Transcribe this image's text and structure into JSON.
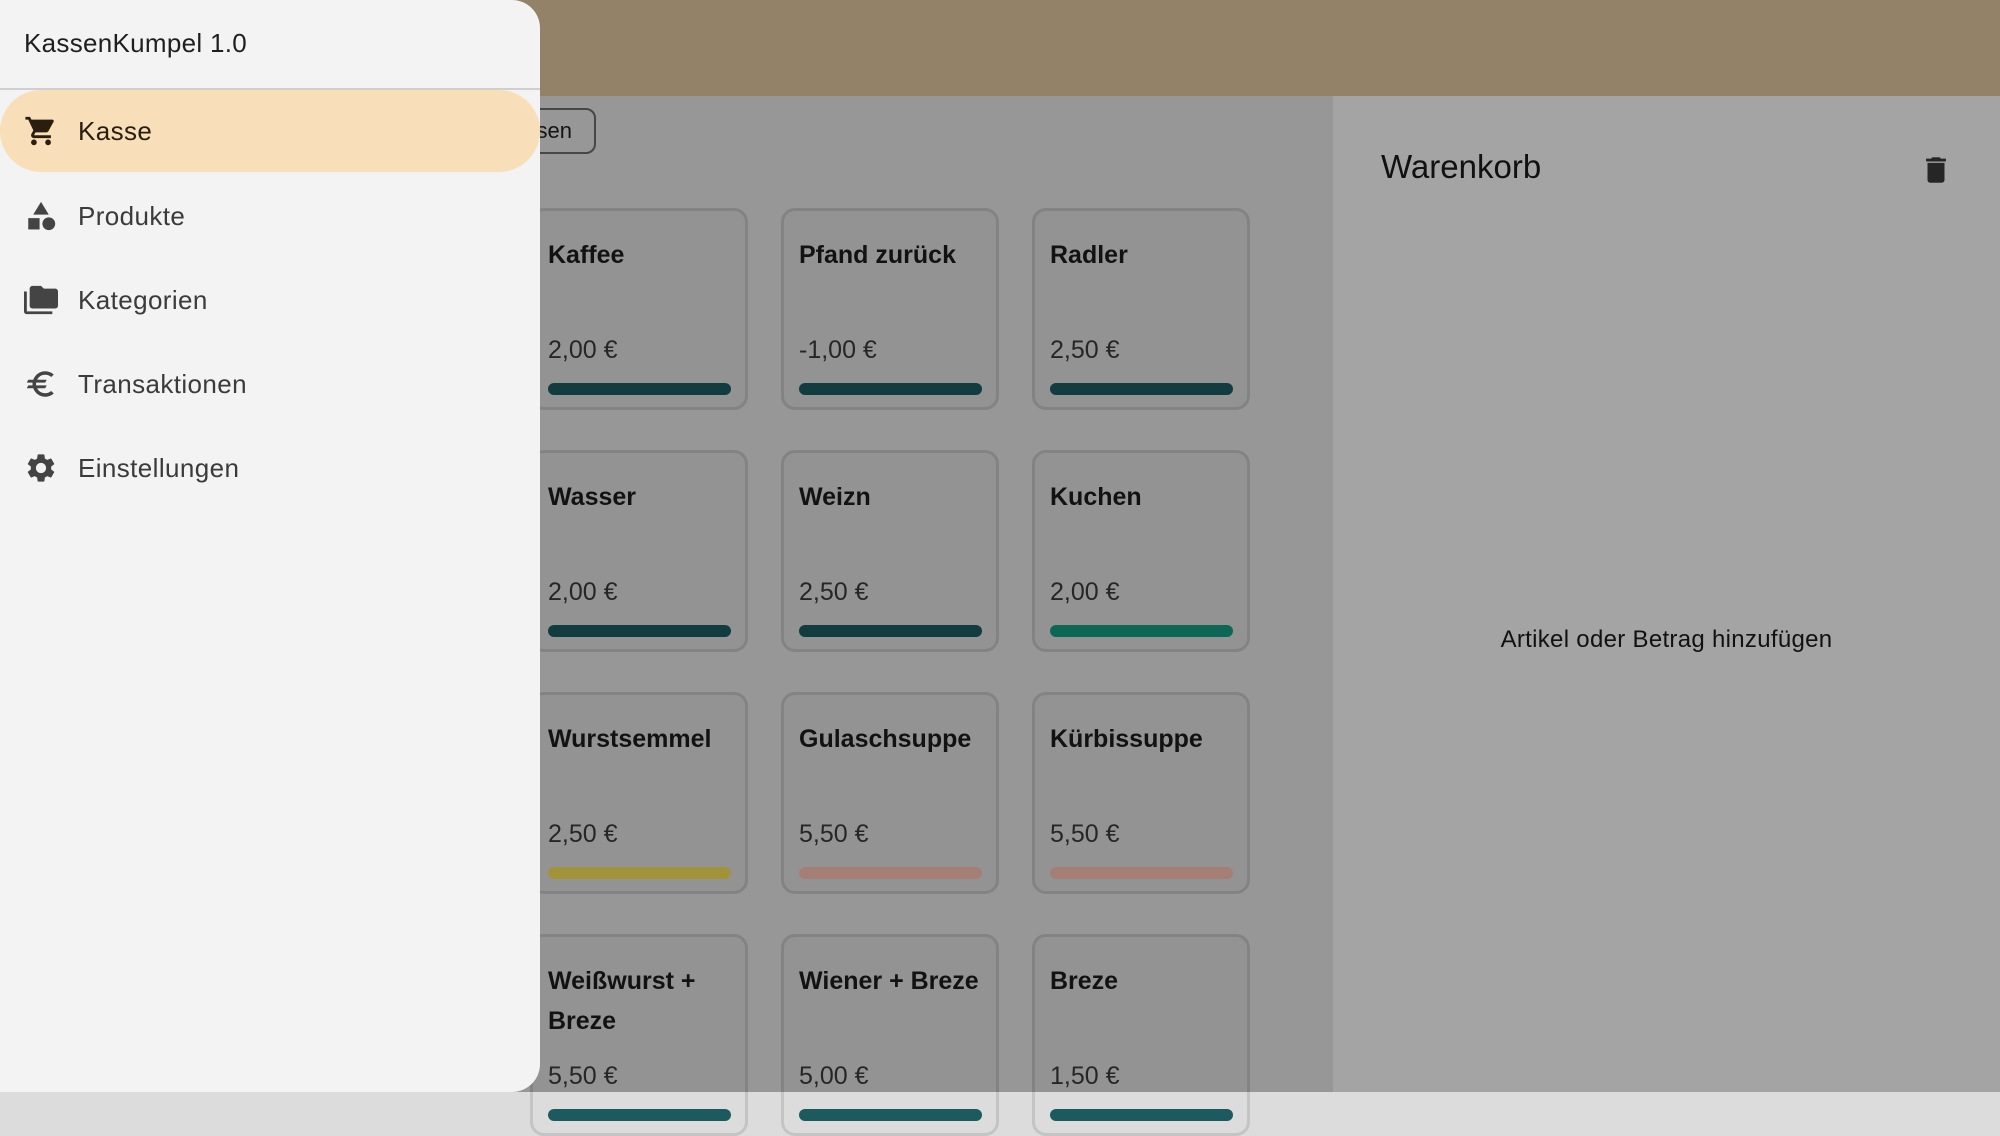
{
  "app": {
    "title": "KassenKumpel 1.0"
  },
  "drawer": {
    "items": [
      {
        "label": "Kasse",
        "icon": "cart-icon",
        "active": true
      },
      {
        "label": "Produkte",
        "icon": "shapes-icon",
        "active": false
      },
      {
        "label": "Kategorien",
        "icon": "folder-icon",
        "active": false
      },
      {
        "label": "Transaktionen",
        "icon": "euro-icon",
        "active": false
      },
      {
        "label": "Einstellungen",
        "icon": "gear-icon",
        "active": false
      }
    ]
  },
  "filter": {
    "visible_label": "sen"
  },
  "products": [
    {
      "name": "Kaffee",
      "price": "2,00 €",
      "color": "#1c5a5f"
    },
    {
      "name": "Pfand zurück",
      "price": "-1,00 €",
      "color": "#1c5a5f"
    },
    {
      "name": "Radler",
      "price": "2,50 €",
      "color": "#1c5a5f"
    },
    {
      "name": "Wasser",
      "price": "2,00 €",
      "color": "#1c5a5f"
    },
    {
      "name": "Weizn",
      "price": "2,50 €",
      "color": "#1c5a5f"
    },
    {
      "name": "Kuchen",
      "price": "2,00 €",
      "color": "#159a7e"
    },
    {
      "name": "Wurstsemmel",
      "price": "2,50 €",
      "color": "#f0dc5a"
    },
    {
      "name": "Gulaschsuppe",
      "price": "5,50 €",
      "color": "#f7bcaf"
    },
    {
      "name": "Kürbissuppe",
      "price": "5,50 €",
      "color": "#f7bcaf"
    },
    {
      "name": "Weißwurst + Breze",
      "price": "5,50 €",
      "color": "#1c5a5f"
    },
    {
      "name": "Wiener + Breze",
      "price": "5,00 €",
      "color": "#1c5a5f"
    },
    {
      "name": "Breze",
      "price": "1,50 €",
      "color": "#1c5a5f"
    }
  ],
  "cart": {
    "title": "Warenkorb",
    "empty_message": "Artikel oder Betrag hinzufügen"
  }
}
